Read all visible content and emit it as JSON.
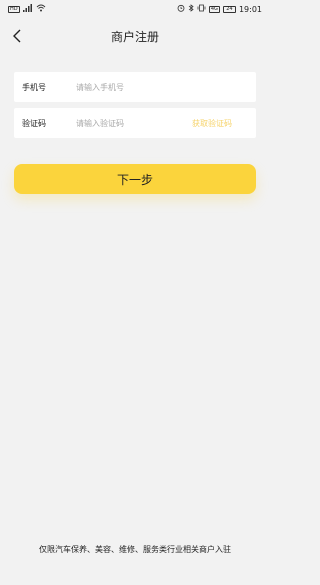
{
  "status_bar": {
    "hd_badge": "HD",
    "signal_text": "4G",
    "battery_text": "24",
    "time": "19:01"
  },
  "header": {
    "title": "商户注册"
  },
  "form": {
    "phone": {
      "label": "手机号",
      "placeholder": "请输入手机号",
      "value": ""
    },
    "code": {
      "label": "验证码",
      "placeholder": "请输入验证码",
      "value": "",
      "get_code_label": "获取验证码"
    }
  },
  "next_button": {
    "label": "下一步"
  },
  "footer": {
    "note": "仅限汽车保养、美容、维修、服务类行业相关商户入驻"
  },
  "colors": {
    "accent": "#fbd43c",
    "get_code_text": "#f6d36a",
    "background": "#f2f2f2"
  }
}
